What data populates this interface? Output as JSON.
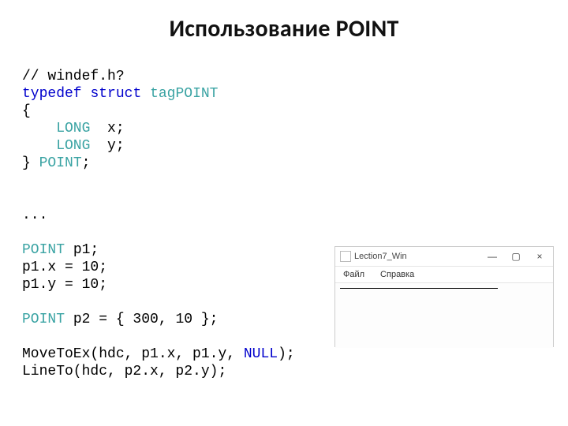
{
  "title": "Использование POINT",
  "code": {
    "l1_comment": "// windef.h?",
    "l2_typedef": "typedef",
    "l2_struct": "struct",
    "l2_tag": "tagPOINT",
    "l3_brace_open": "{",
    "l4_long": "    LONG",
    "l4_x": "  x;",
    "l5_long": "    LONG",
    "l5_y": "  y;",
    "l6_brace_close": "} ",
    "l6_point": "POINT",
    "l6_semi": ";",
    "l7_blank": " ",
    "l8_blank": " ",
    "l9_dots": "...",
    "l10_blank": " ",
    "l11_point_t": "POINT",
    "l11_rest": " p1;",
    "l12": "p1.x = 10;",
    "l13": "p1.y = 10;",
    "l14_blank": " ",
    "l15_point_t": "POINT",
    "l15_rest": " p2 = { 300, 10 };",
    "l16_blank": " ",
    "l17_a": "MoveToEx(hdc, p1.x, p1.y, ",
    "l17_null": "NULL",
    "l17_b": ");",
    "l18": "LineTo(hdc, p2.x, p2.y);"
  },
  "appwin": {
    "title": "Lection7_Win",
    "btn_min": "—",
    "btn_max": "▢",
    "btn_close": "×",
    "menu_file": "Файл",
    "menu_help": "Справка"
  }
}
